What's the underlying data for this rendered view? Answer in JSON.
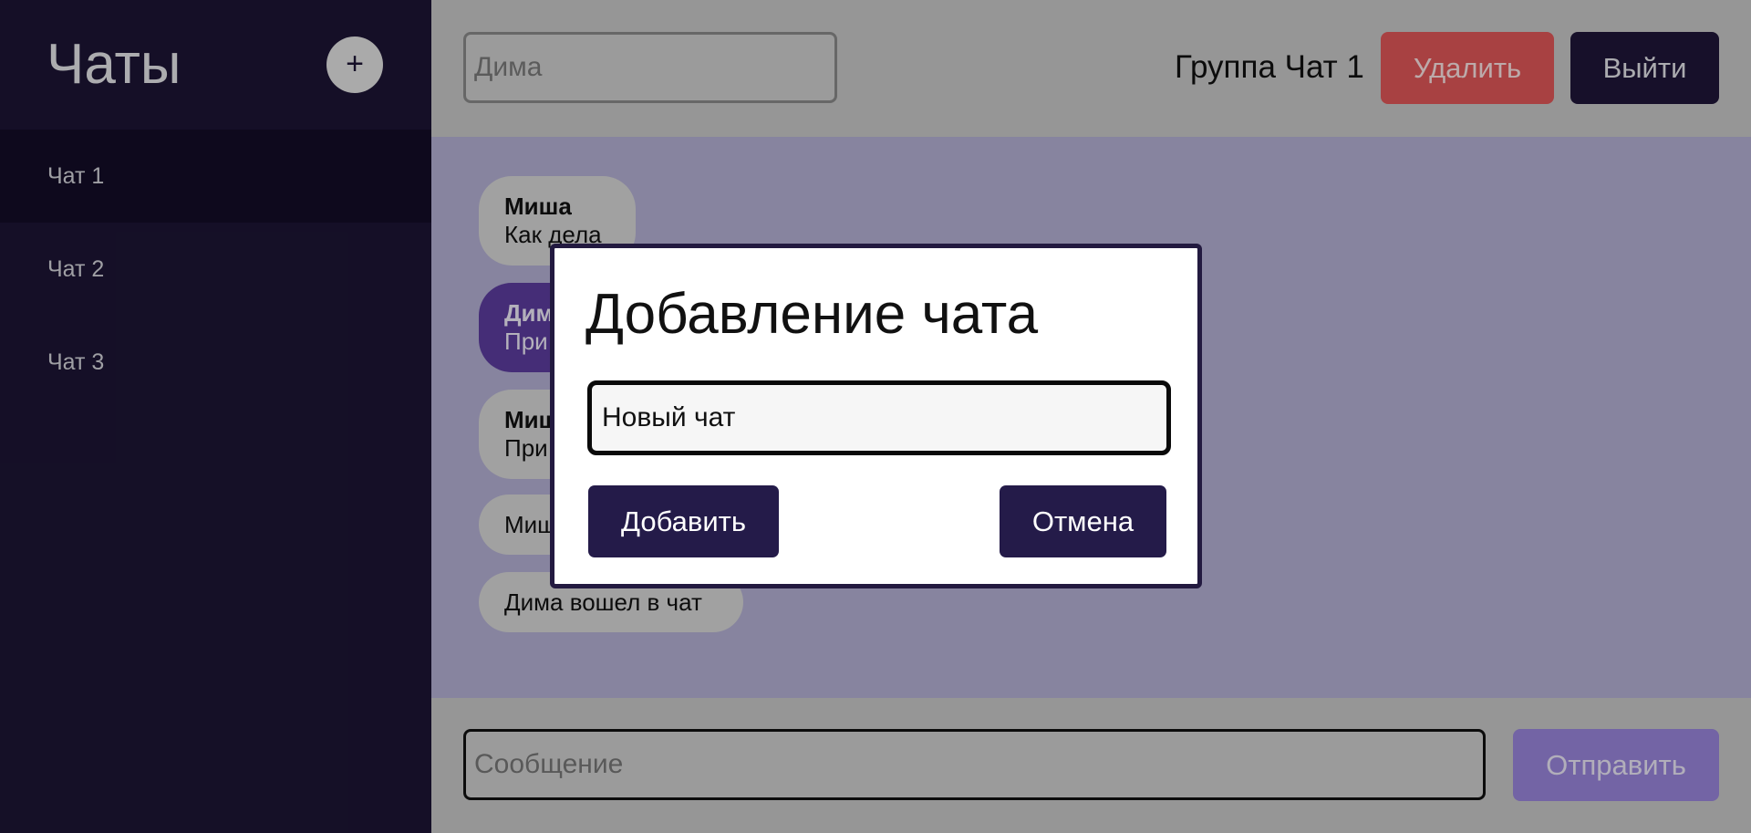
{
  "sidebar": {
    "title": "Чаты",
    "add_button": "+",
    "items": [
      {
        "label": "Чат 1"
      },
      {
        "label": "Чат 2"
      },
      {
        "label": "Чат 3"
      }
    ]
  },
  "header": {
    "user_input_placeholder": "Дима",
    "group_title": "Группа Чат 1",
    "delete_label": "Удалить",
    "exit_label": "Выйти"
  },
  "messages": [
    {
      "author": "Миша",
      "text": "Как дела"
    },
    {
      "author": "Дим",
      "text": "При"
    },
    {
      "author": "Миш",
      "text": "При"
    },
    {
      "text": "Миш"
    },
    {
      "text": "Дима вошел в чат"
    }
  ],
  "composer": {
    "placeholder": "Сообщение",
    "send_label": "Отправить"
  },
  "dialog": {
    "title": "Добавление чата",
    "input_value": "Новый чат",
    "add_label": "Добавить",
    "cancel_label": "Отмена"
  },
  "colors": {
    "sidebar_bg": "#1c1534",
    "accent_dark": "#241b49",
    "delete_red": "#e05758",
    "send_purple": "#9a86dc",
    "own_bubble": "#5c3d9f"
  }
}
